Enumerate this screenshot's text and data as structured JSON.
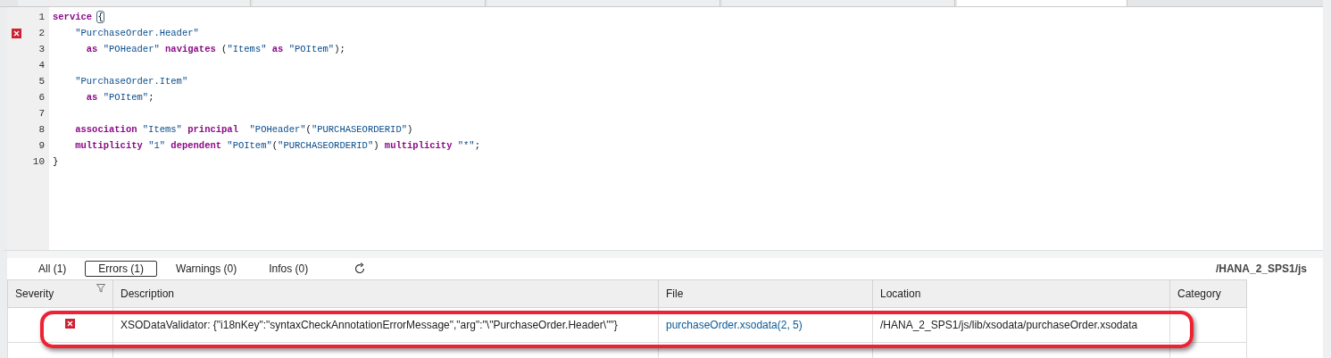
{
  "editor": {
    "lines": [
      {
        "number": "1",
        "error": false,
        "segments": [
          {
            "kind": "keyword",
            "text": "service "
          },
          {
            "kind": "bracket-match",
            "text": "{"
          }
        ]
      },
      {
        "number": "2",
        "error": true,
        "segments": [
          {
            "kind": "string",
            "text": "    \"PurchaseOrder.Header\""
          }
        ]
      },
      {
        "number": "3",
        "error": false,
        "segments": [
          {
            "kind": "keyword",
            "text": "      as"
          },
          {
            "kind": "string",
            "text": " \"POHeader\" "
          },
          {
            "kind": "keyword",
            "text": "navigates"
          },
          {
            "kind": "plain",
            "text": " ("
          },
          {
            "kind": "string",
            "text": "\"Items\" "
          },
          {
            "kind": "keyword",
            "text": "as"
          },
          {
            "kind": "string",
            "text": " \"POItem\""
          },
          {
            "kind": "plain",
            "text": ");"
          }
        ]
      },
      {
        "number": "4",
        "error": false
      },
      {
        "number": "5",
        "error": false,
        "segments": [
          {
            "kind": "string",
            "text": "    \"PurchaseOrder.Item\""
          }
        ]
      },
      {
        "number": "6",
        "error": false,
        "segments": [
          {
            "kind": "keyword",
            "text": "      as"
          },
          {
            "kind": "string",
            "text": " \"POItem\""
          },
          {
            "kind": "plain",
            "text": ";"
          }
        ]
      },
      {
        "number": "7",
        "error": false
      },
      {
        "number": "8",
        "error": false,
        "segments": [
          {
            "kind": "keyword",
            "text": "    association"
          },
          {
            "kind": "string",
            "text": " \"Items\" "
          },
          {
            "kind": "keyword",
            "text": "principal"
          },
          {
            "kind": "string",
            "text": "  \"POHeader\""
          },
          {
            "kind": "plain",
            "text": "("
          },
          {
            "kind": "string",
            "text": "\"PURCHASEORDERID\""
          },
          {
            "kind": "plain",
            "text": ")"
          }
        ]
      },
      {
        "number": "9",
        "error": false,
        "segments": [
          {
            "kind": "keyword",
            "text": "    multiplicity"
          },
          {
            "kind": "string",
            "text": " \"1\" "
          },
          {
            "kind": "keyword",
            "text": "dependent"
          },
          {
            "kind": "string",
            "text": " \"POItem\""
          },
          {
            "kind": "plain",
            "text": "("
          },
          {
            "kind": "string",
            "text": "\"PURCHASEORDERID\""
          },
          {
            "kind": "plain",
            "text": ") "
          },
          {
            "kind": "keyword",
            "text": "multiplicity"
          },
          {
            "kind": "string",
            "text": " \"*\""
          },
          {
            "kind": "plain",
            "text": ";"
          }
        ]
      },
      {
        "number": "10",
        "error": false,
        "segments": [
          {
            "kind": "plain",
            "text": "}"
          }
        ]
      }
    ]
  },
  "problems": {
    "filters": [
      {
        "label": "All (1)",
        "selected": false
      },
      {
        "label": "Errors (1)",
        "selected": true
      },
      {
        "label": "Warnings (0)",
        "selected": false
      },
      {
        "label": "Infos (0)",
        "selected": false
      }
    ],
    "path": "/HANA_2_SPS1/js",
    "columns": [
      "Severity",
      "Description",
      "File",
      "Location",
      "Category"
    ],
    "rows": [
      {
        "kind": "error",
        "description": "XSODataValidator: {\"i18nKey\":\"syntaxCheckAnnotationErrorMessage\",\"arg\":\"\\\"PurchaseOrder.Header\\\"\"}",
        "file": "purchaseOrder.xsodata(2, 5)",
        "location": "/HANA_2_SPS1/js/lib/xsodata/purchaseOrder.xsodata",
        "highlighted": true
      }
    ]
  }
}
